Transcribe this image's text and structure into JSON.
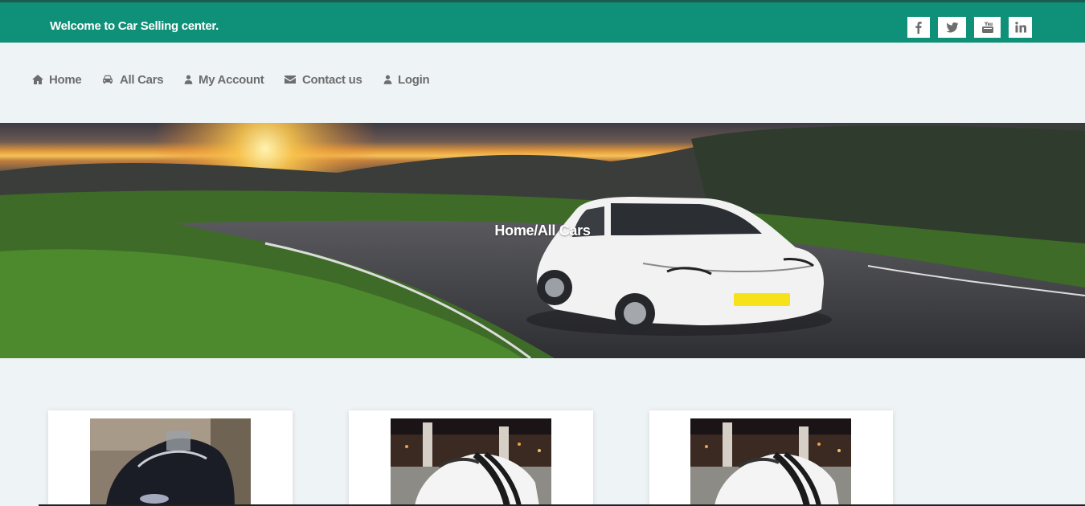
{
  "topbar": {
    "welcome_text": "Welcome to Car Selling center.",
    "background": "#0f9078",
    "social": [
      {
        "name": "facebook",
        "icon": "facebook-icon"
      },
      {
        "name": "twitter",
        "icon": "twitter-icon"
      },
      {
        "name": "youtube",
        "icon": "youtube-icon"
      },
      {
        "name": "linkedin",
        "icon": "linkedin-icon"
      }
    ]
  },
  "nav": {
    "items": [
      {
        "label": "Home",
        "icon": "home-icon"
      },
      {
        "label": "All Cars",
        "icon": "car-icon"
      },
      {
        "label": "My Account",
        "icon": "user-icon"
      },
      {
        "label": "Contact us",
        "icon": "envelope-icon"
      },
      {
        "label": "Login",
        "icon": "user-icon"
      }
    ]
  },
  "hero": {
    "breadcrumb": "Home/All Cars"
  },
  "cards": [
    {
      "image": "black convertible car"
    },
    {
      "image": "white convertible car with black stripes"
    },
    {
      "image": "white convertible car with black stripes"
    }
  ]
}
